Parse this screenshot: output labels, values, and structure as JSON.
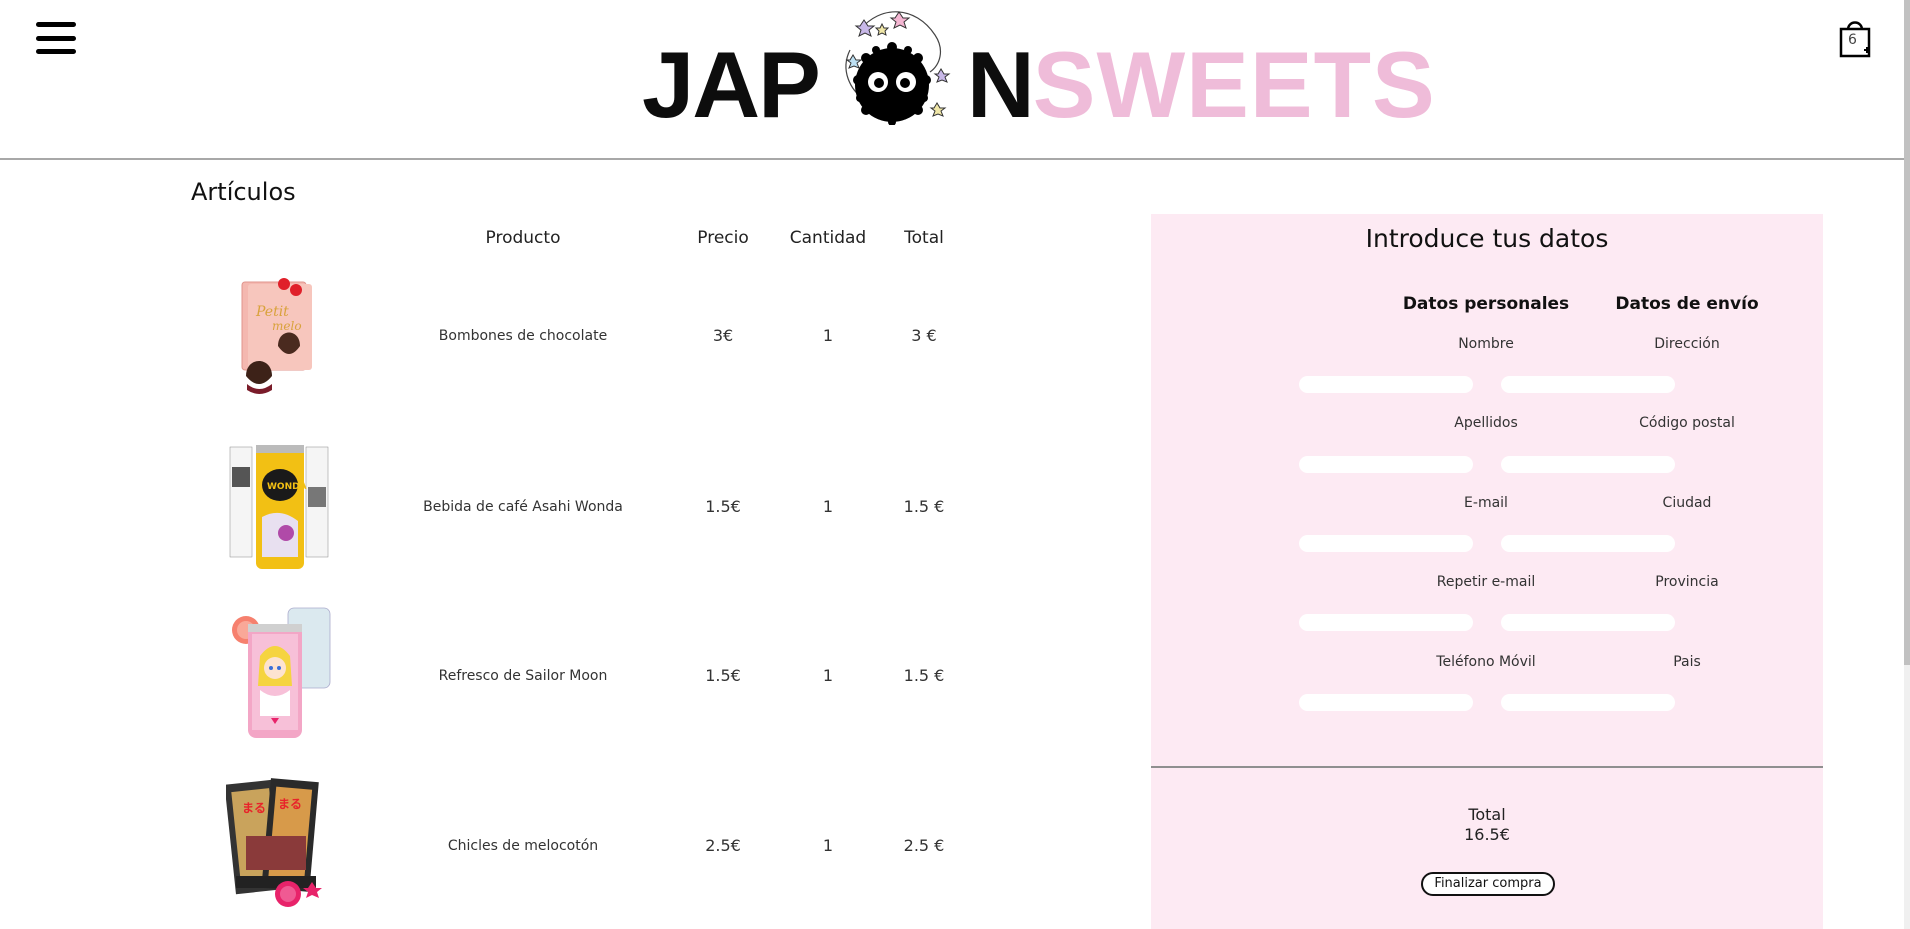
{
  "header": {
    "logo_part1": "JAP",
    "logo_part2": "N",
    "logo_part3": "SWEETS",
    "cart_count": "6"
  },
  "articles": {
    "title": "Artículos",
    "columns": [
      "Producto",
      "Precio",
      "Cantidad",
      "Total"
    ],
    "rows": [
      {
        "name": "Bombones de chocolate",
        "price": "3€",
        "qty": "1",
        "total": "3 €"
      },
      {
        "name": "Bebida de café Asahi Wonda",
        "price": "1.5€",
        "qty": "1",
        "total": "1.5 €"
      },
      {
        "name": "Refresco de Sailor Moon",
        "price": "1.5€",
        "qty": "1",
        "total": "1.5 €"
      },
      {
        "name": "Chicles de melocotón",
        "price": "2.5€",
        "qty": "1",
        "total": "2.5 €"
      }
    ]
  },
  "form": {
    "title": "Introduce tus datos",
    "personal_title": "Datos personales",
    "shipping_title": "Datos de envío",
    "personal_fields": [
      "Nombre",
      "Apellidos",
      "E-mail",
      "Repetir e-mail",
      "Teléfono Móvil"
    ],
    "shipping_fields": [
      "Dirección",
      "Código postal",
      "Ciudad",
      "Provincia",
      "Pais"
    ],
    "total_label": "Total",
    "total_value": "16.5€",
    "finish_label": "Finalizar compra"
  },
  "colors": {
    "pink_logo": "#efbcd9",
    "panel_bg": "#fdeaf3"
  }
}
